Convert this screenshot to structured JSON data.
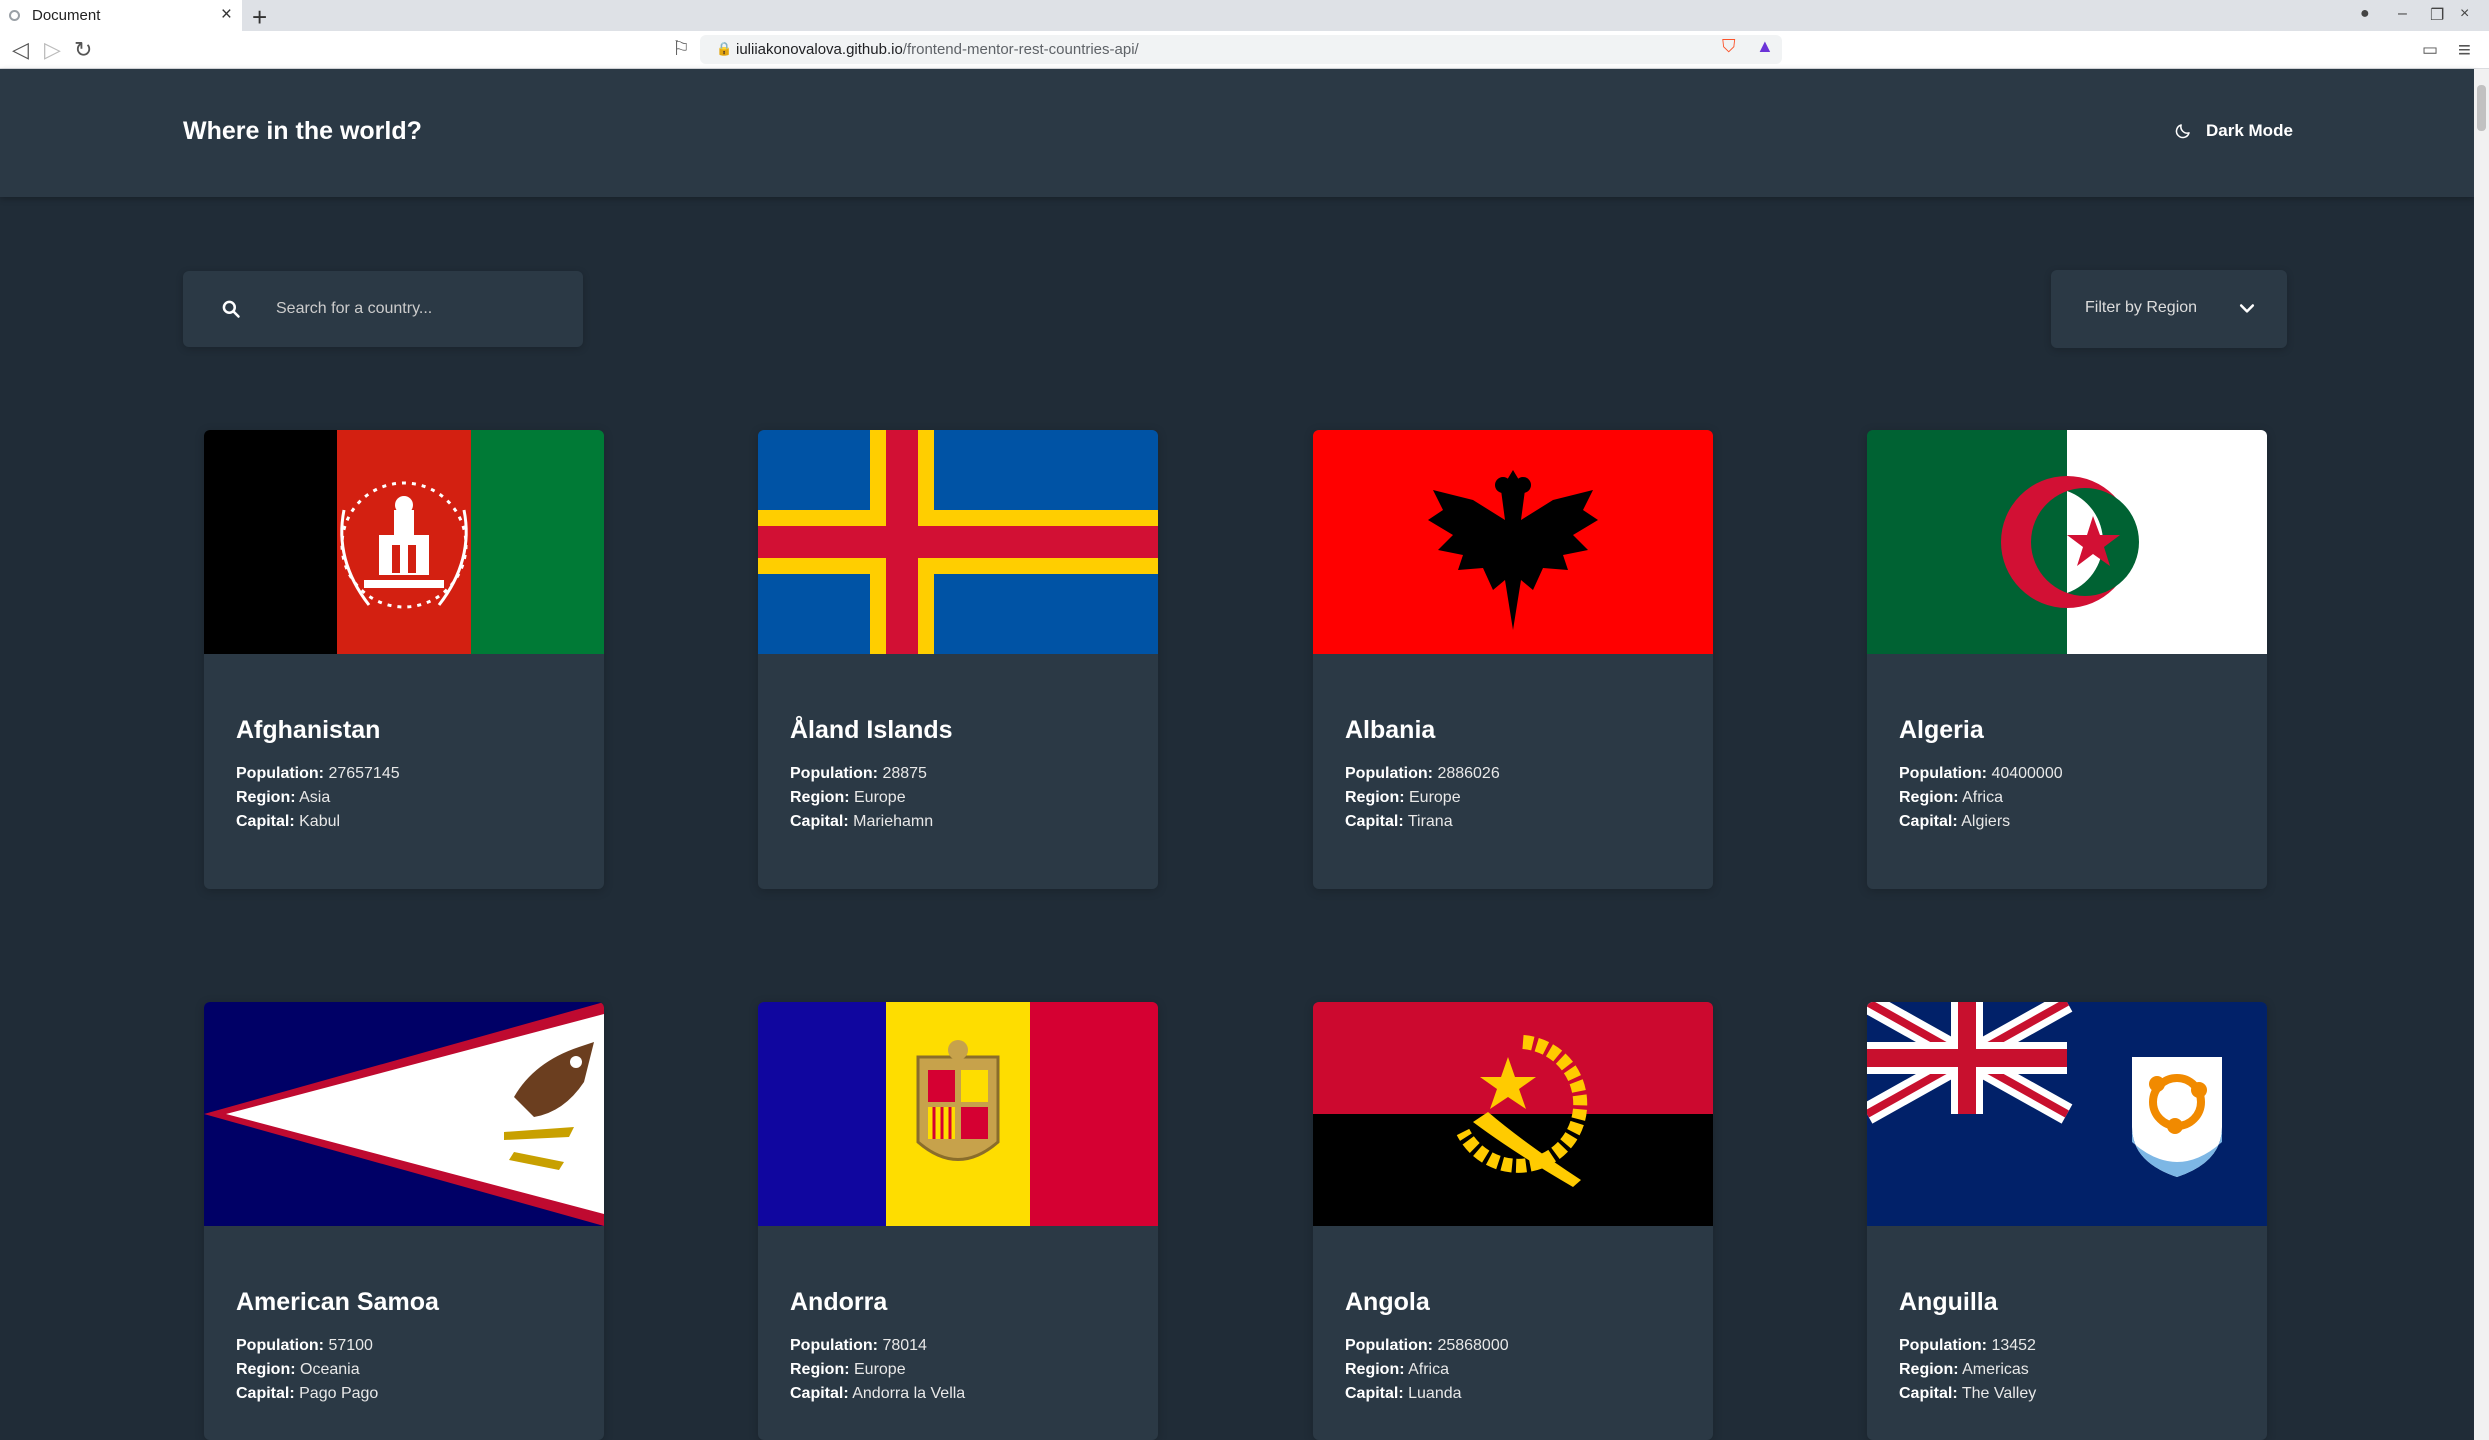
{
  "browser": {
    "tab_title": "Document",
    "url_host": "iuliiakonovalova.github.io",
    "url_path": "/frontend-mentor-rest-countries-api/"
  },
  "header": {
    "title": "Where in the world?",
    "dark_mode_label": "Dark Mode"
  },
  "search": {
    "placeholder": "Search for a country..."
  },
  "filter": {
    "label": "Filter by Region"
  },
  "labels": {
    "population": "Population:",
    "region": "Region:",
    "capital": "Capital:"
  },
  "countries": [
    {
      "name": "Afghanistan",
      "population": "27657145",
      "region": "Asia",
      "capital": "Kabul",
      "flag": "afghanistan-flag"
    },
    {
      "name": "Åland Islands",
      "population": "28875",
      "region": "Europe",
      "capital": "Mariehamn",
      "flag": "aland-flag"
    },
    {
      "name": "Albania",
      "population": "2886026",
      "region": "Europe",
      "capital": "Tirana",
      "flag": "albania-flag"
    },
    {
      "name": "Algeria",
      "population": "40400000",
      "region": "Africa",
      "capital": "Algiers",
      "flag": "algeria-flag"
    },
    {
      "name": "American Samoa",
      "population": "57100",
      "region": "Oceania",
      "capital": "Pago Pago",
      "flag": "american-samoa-flag"
    },
    {
      "name": "Andorra",
      "population": "78014",
      "region": "Europe",
      "capital": "Andorra la Vella",
      "flag": "andorra-flag"
    },
    {
      "name": "Angola",
      "population": "25868000",
      "region": "Africa",
      "capital": "Luanda",
      "flag": "angola-flag"
    },
    {
      "name": "Anguilla",
      "population": "13452",
      "region": "Americas",
      "capital": "The Valley",
      "flag": "anguilla-flag"
    }
  ],
  "colors": {
    "background": "#202c37",
    "element": "#2b3945",
    "text": "#ffffff"
  }
}
